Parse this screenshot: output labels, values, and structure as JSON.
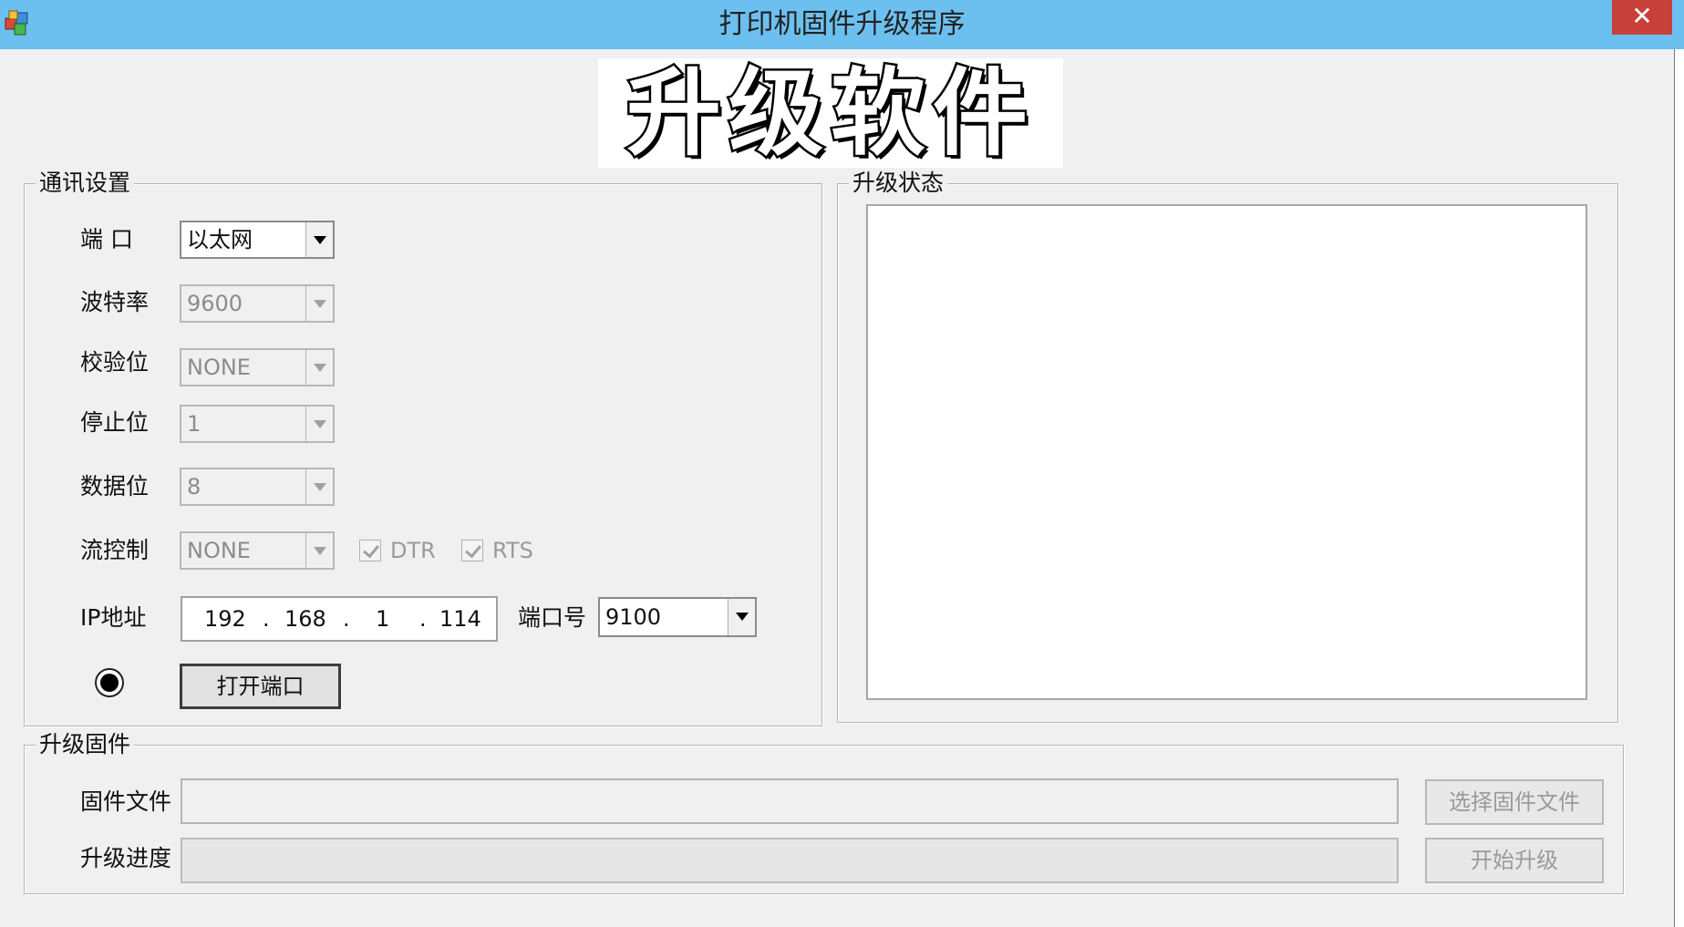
{
  "window": {
    "title": "打印机固件升级程序",
    "close_symbol": "✕",
    "close_color": "#c7413a",
    "titlebar_color": "#6cc0f0",
    "app_icon": "app-cubes-icon"
  },
  "banner": {
    "text": "升级软件"
  },
  "comm": {
    "legend": "通讯设置",
    "port_label": "端  口",
    "port_value": "以太网",
    "baud_label": "波特率",
    "baud_value": "9600",
    "parity_label": "校验位",
    "parity_value": "NONE",
    "stopbits_label": "停止位",
    "stopbits_value": "1",
    "databits_label": "数据位",
    "databits_value": "8",
    "flow_label": "流控制",
    "flow_value": "NONE",
    "dtr_label": "DTR",
    "dtr_checked": true,
    "rts_label": "RTS",
    "rts_checked": true,
    "ip_label": "IP地址",
    "ip": {
      "octet1": "192",
      "octet2": "168",
      "octet3": "1",
      "octet4": "114",
      "dot": "."
    },
    "portnum_label": "端口号",
    "portnum_value": "9100",
    "open_button": "打开端口"
  },
  "status": {
    "legend": "升级状态",
    "log_text": ""
  },
  "firmware": {
    "legend": "升级固件",
    "file_label": "固件文件",
    "file_value": "",
    "progress_label": "升级进度",
    "progress": 0,
    "select_button": "选择固件文件",
    "start_button": "开始升级"
  }
}
